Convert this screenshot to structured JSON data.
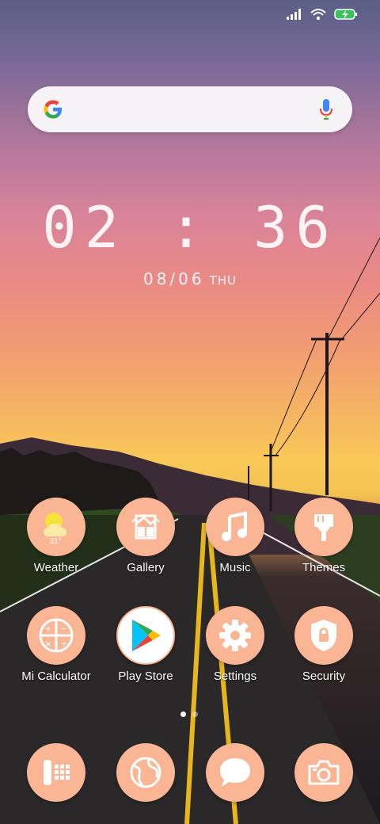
{
  "status_bar": {
    "icons": [
      "signal-icon",
      "wifi-icon",
      "battery-charging-icon"
    ]
  },
  "search_bar": {
    "logo": "google-logo",
    "voice_icon": "mic-icon"
  },
  "clock": {
    "time": "02 : 36",
    "date": "08/06",
    "day": "THU"
  },
  "apps_row1": [
    {
      "label": "Weather",
      "icon": "weather-icon",
      "temp": "31°"
    },
    {
      "label": "Gallery",
      "icon": "gallery-icon"
    },
    {
      "label": "Music",
      "icon": "music-icon"
    },
    {
      "label": "Themes",
      "icon": "themes-icon"
    }
  ],
  "apps_row2": [
    {
      "label": "Mi Calculator",
      "icon": "calculator-icon"
    },
    {
      "label": "Play Store",
      "icon": "play-store-icon"
    },
    {
      "label": "Settings",
      "icon": "settings-icon"
    },
    {
      "label": "Security",
      "icon": "security-icon"
    }
  ],
  "page_indicator": {
    "total": 2,
    "current": 1
  },
  "dock": [
    {
      "icon": "phone-icon"
    },
    {
      "icon": "browser-icon"
    },
    {
      "icon": "messages-icon"
    },
    {
      "icon": "camera-icon"
    }
  ],
  "colors": {
    "icon_bg": "#f9b594",
    "label": "#ffffff"
  }
}
